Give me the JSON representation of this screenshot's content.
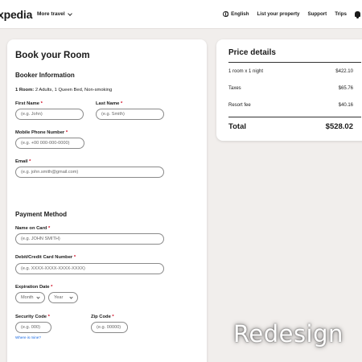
{
  "header": {
    "logo": "xpedia",
    "more_travel": "More travel",
    "language": "English",
    "list_property": "List your property",
    "support": "Support",
    "trips": "Trips"
  },
  "booking": {
    "title": "Book your Room",
    "booker_heading": "Booker Information",
    "room_bold": "1 Room:",
    "room_detail": " 2 Adults, 1 Queen Bed,  Non-smoking",
    "first_name_label": "First Name",
    "first_name_placeholder": "(e.g. John)",
    "last_name_label": "Last Name",
    "last_name_placeholder": "(e.g. Smith)",
    "phone_label": "Mobile Phone Number",
    "phone_placeholder": "(e.g. +00 000-000-0000)",
    "email_label": "Email",
    "email_placeholder": "(e.g. john.smith@gmail.com)",
    "payment_heading": "Payment Method",
    "name_on_card_label": "Name on Card",
    "name_on_card_placeholder": "(e.g. JOHN SMITH)",
    "card_number_label": "Debit/Credit Card Number",
    "card_number_placeholder": "(e.g. XXXX-XXXX-XXXX-XXXX)",
    "expiration_label": "Expiration Date",
    "month_placeholder": "Month",
    "year_placeholder": "Year",
    "security_code_label": "Security Code",
    "security_code_placeholder": "(e.g. 000)",
    "zip_code_label": "Zip Code",
    "zip_code_placeholder": "(e.g. 00000)",
    "where_is_mine": "Where is mine?",
    "required_mark": "*"
  },
  "price": {
    "title": "Price details",
    "rows": [
      {
        "label": "1 room x 1 night",
        "value": "$422.10"
      },
      {
        "label": "Taxes",
        "value": "$65.76"
      },
      {
        "label": "Resort fee",
        "value": "$40.16"
      }
    ],
    "total_label": "Total",
    "total_value": "$528.02"
  },
  "watermark": "Redesign",
  "colors": {
    "required": "#d0021b",
    "link": "#1668e3",
    "background": "#f1eeec"
  }
}
